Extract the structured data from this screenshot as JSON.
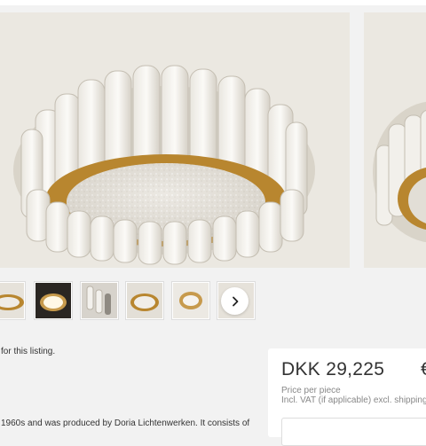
{
  "listing": {
    "note_fragment": "for this listing.",
    "description_fragment": "1960s and was produced by Doria Lichtenwerken. It consists of"
  },
  "gallery": {
    "main_image": "ceiling-lamp-glass-tubes-photo",
    "thumbnails": [
      {
        "name": "lamp-front-view"
      },
      {
        "name": "lamp-lit-dark-view"
      },
      {
        "name": "lamp-detail-view"
      },
      {
        "name": "lamp-underside-view"
      },
      {
        "name": "lamp-ring-view"
      },
      {
        "name": "lamp-partial-view"
      }
    ],
    "next_icon": "chevron-right-icon"
  },
  "purchase": {
    "price": "DKK 29,225",
    "price_overflow": "€",
    "unit": "Price per piece",
    "vat_note": "Incl. VAT (if applicable) excl. shipping"
  },
  "colors": {
    "background": "#f2f2f2",
    "card": "#ffffff",
    "text": "#333333",
    "muted": "#888888",
    "brass": "#b8862f"
  }
}
